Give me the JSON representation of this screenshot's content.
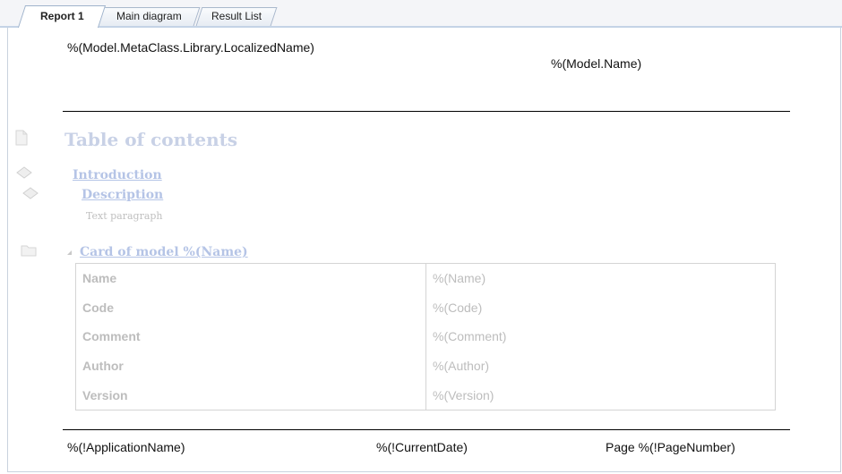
{
  "tabs": [
    {
      "label": "Report 1",
      "active": true
    },
    {
      "label": "Main diagram",
      "active": false
    },
    {
      "label": "Result List",
      "active": false
    }
  ],
  "header": {
    "left": "%(Model.MetaClass.Library.LocalizedName)",
    "right": "%(Model.Name)"
  },
  "toc": {
    "title": "Table of contents",
    "introduction": "Introduction",
    "description": "Description",
    "paragraph": "Text paragraph"
  },
  "card": {
    "title": "Card of model %(Name)",
    "rows": [
      {
        "label": "Name",
        "value": "%(Name)"
      },
      {
        "label": "Code",
        "value": "%(Code)"
      },
      {
        "label": "Comment",
        "value": "%(Comment)"
      },
      {
        "label": "Author",
        "value": "%(Author)"
      },
      {
        "label": "Version",
        "value": "%(Version)"
      }
    ]
  },
  "footer": {
    "app": "%(!ApplicationName)",
    "date": "%(!CurrentDate)",
    "page": "Page %(!PageNumber)"
  },
  "icons": [
    "page-icon",
    "book-stack-icon",
    "folder-icon"
  ],
  "colors": {
    "tab_border": "#a9b8cc",
    "ghost_link": "#b5c4e6",
    "ghost_text": "#bdbdbd"
  }
}
